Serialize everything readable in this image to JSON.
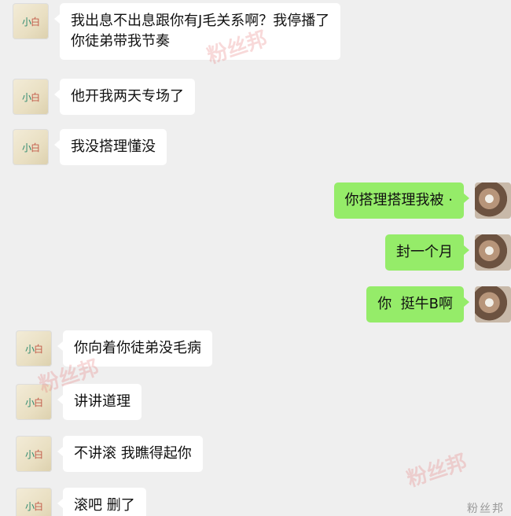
{
  "messages": [
    {
      "side": "left",
      "text": "我出息不出息跟你有J毛关系啊？我停播了\n你徒弟带我节奏"
    },
    {
      "side": "left",
      "text": "他开我两天专场了"
    },
    {
      "side": "left",
      "text": "我没搭理懂没"
    },
    {
      "side": "right",
      "text": "你搭理搭理我被 ·"
    },
    {
      "side": "right",
      "text": "封一个月"
    },
    {
      "side": "right",
      "text": "你  挺牛B啊"
    },
    {
      "side": "left",
      "text": "你向着你徒弟没毛病"
    },
    {
      "side": "left",
      "text": "讲讲道理"
    },
    {
      "side": "left",
      "text": "不讲滚 我瞧得起你"
    },
    {
      "side": "left",
      "text": "滚吧 删了"
    }
  ],
  "watermarks": [
    "粉丝邦",
    "粉丝邦",
    "粉丝邦"
  ],
  "corner_text": "粉丝邦"
}
